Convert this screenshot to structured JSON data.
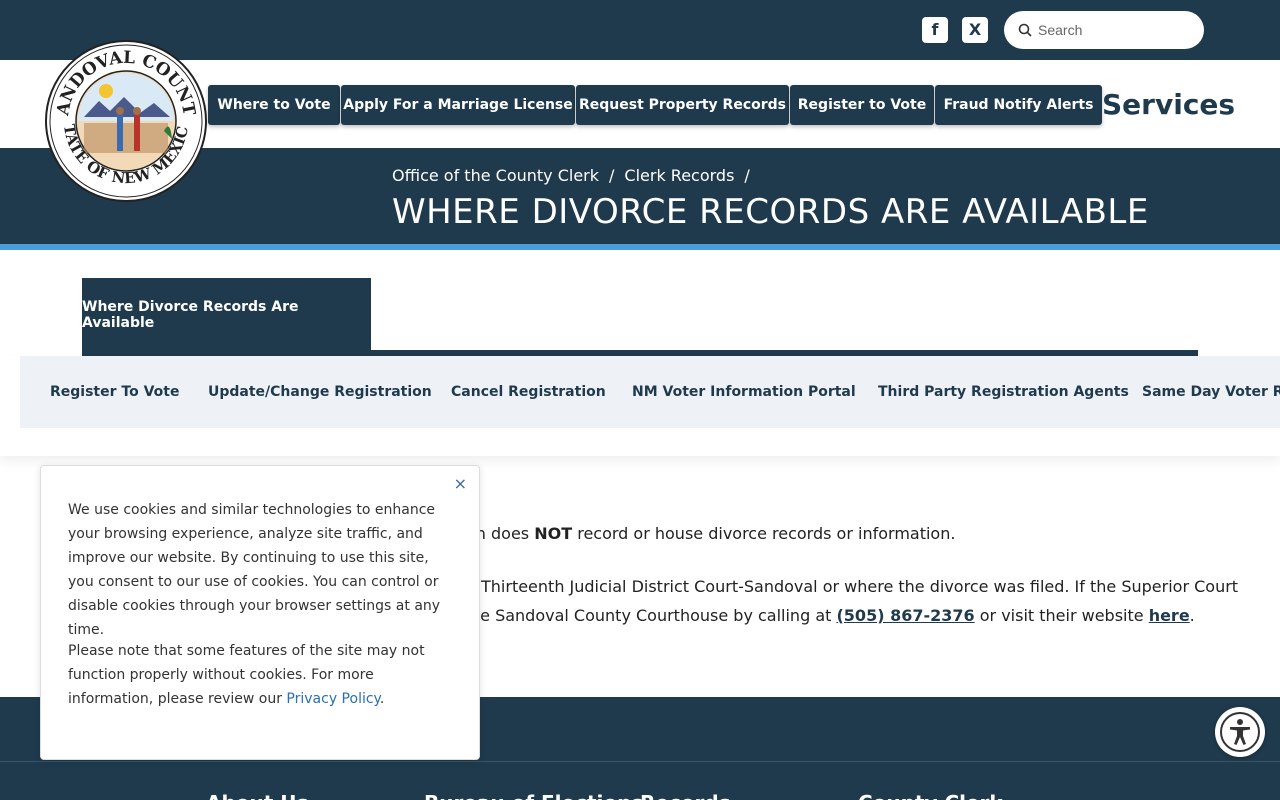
{
  "header": {
    "social": [
      {
        "name": "facebook",
        "glyph": "f"
      },
      {
        "name": "x",
        "glyph": "X"
      }
    ],
    "search": {
      "placeholder": "Search"
    }
  },
  "seal": {
    "top_text": "SANDOVAL COUNTY",
    "bottom_text": "STATE OF NEW MEXICO"
  },
  "nav": {
    "buttons": [
      "Where to Vote",
      "Apply For a Marriage License",
      "Request Property Records",
      "Register to Vote",
      "Fraud Notify Alerts"
    ],
    "services_label": "Services"
  },
  "hero": {
    "breadcrumbs": [
      "Office of the County Clerk",
      "Clerk Records"
    ],
    "separator": "/",
    "title": "WHERE DIVORCE RECORDS ARE AVAILABLE"
  },
  "subnav": {
    "active_tab": "Where Divorce Records Are Available",
    "items": [
      "Register To Vote",
      "Update/Change Registration",
      "Cancel Registration",
      "NM Voter Information Portal",
      "Third Party Registration Agents",
      "Same Day Voter Registration"
    ]
  },
  "content": {
    "line1_pre": "on does ",
    "line1_bold": "NOT",
    "line1_post": " record or house divorce records or information.",
    "line2": "Thirteenth Judicial District Court-Sandoval or where the divorce was filed. If the Superior Court",
    "line3_pre": "he Sandoval County Courthouse by calling at ",
    "phone": "(505) 867-2376",
    "line3_mid": " or visit their website ",
    "link": "here",
    "line3_post": "."
  },
  "footer": {
    "headings": [
      "About Us",
      "Bureau of Elections",
      "Records",
      "County Clerk"
    ]
  },
  "cookie": {
    "close": "×",
    "para1": "We use cookies and similar technologies to enhance your browsing experience, analyze site traffic, and improve our website. By continuing to use this site, you consent to our use of cookies. You can control or disable cookies through your browser settings at any time.",
    "para2_pre": "Please note that some features of the site may not function properly without cookies. For more information, please review our ",
    "policy_link": "Privacy Policy",
    "para2_post": "."
  },
  "colors": {
    "primary": "#1f3a4d",
    "accent_stripe": "#4a9fd8",
    "subnav_bg": "#eef2f7",
    "link": "#2a6fb0"
  },
  "icons": [
    "facebook-icon",
    "x-icon",
    "search-icon",
    "seal-logo",
    "close-icon",
    "accessibility-icon"
  ]
}
